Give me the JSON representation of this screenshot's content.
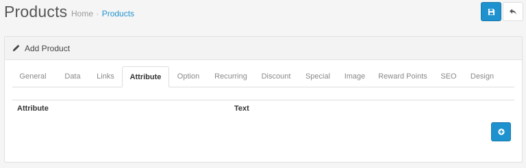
{
  "header": {
    "title": "Products",
    "breadcrumb": [
      {
        "label": "Home"
      },
      {
        "label": "Products"
      }
    ],
    "separator": "›"
  },
  "buttons": {
    "save": {
      "icon": "save-icon",
      "color": "#1e91cf"
    },
    "back": {
      "icon": "reply-icon"
    },
    "add_attribute": {
      "icon": "plus-circle-icon",
      "color": "#1e91cf"
    }
  },
  "panel": {
    "title": "Add Product",
    "title_icon": "pencil-icon"
  },
  "tabs": [
    {
      "label": "General"
    },
    {
      "label": "Data"
    },
    {
      "label": "Links"
    },
    {
      "label": "Attribute",
      "active": true
    },
    {
      "label": "Option"
    },
    {
      "label": "Recurring"
    },
    {
      "label": "Discount"
    },
    {
      "label": "Special"
    },
    {
      "label": "Image"
    },
    {
      "label": "Reward Points"
    },
    {
      "label": "SEO"
    },
    {
      "label": "Design"
    }
  ],
  "attribute_table": {
    "columns": [
      "Attribute",
      "Text"
    ]
  }
}
